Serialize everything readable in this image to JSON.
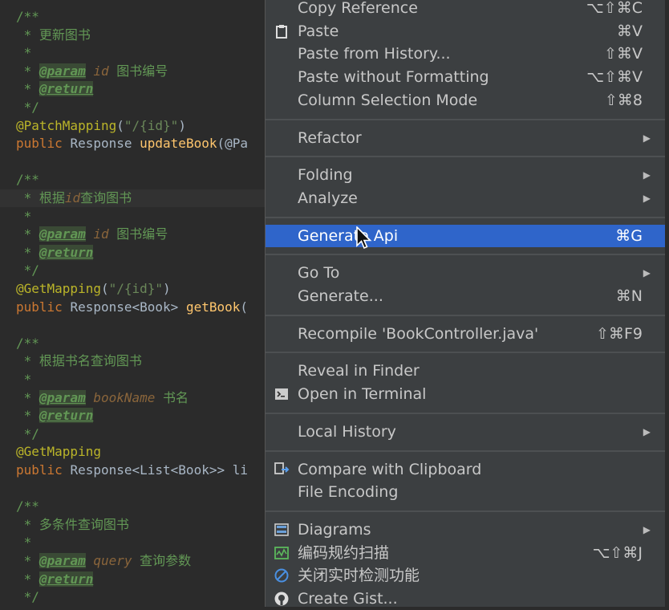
{
  "editor": {
    "lines": [
      [
        [
          "tok-comment",
          "/**"
        ]
      ],
      [
        [
          "tok-comment",
          " * 更新图书"
        ]
      ],
      [
        [
          "tok-comment",
          " *"
        ]
      ],
      [
        [
          "tok-comment",
          " * "
        ],
        [
          "tok-tag",
          "@param"
        ],
        [
          "tok-comment",
          " "
        ],
        [
          "tok-param",
          "id"
        ],
        [
          "tok-comment",
          " 图书编号"
        ]
      ],
      [
        [
          "tok-comment",
          " * "
        ],
        [
          "tok-tag",
          "@return"
        ]
      ],
      [
        [
          "tok-comment",
          " */"
        ]
      ],
      [
        [
          "tok-anno",
          "@PatchMapping"
        ],
        [
          "tok-plain",
          "("
        ],
        [
          "tok-str",
          "\"/{id}\""
        ],
        [
          "tok-plain",
          ")"
        ]
      ],
      [
        [
          "tok-kw",
          "public "
        ],
        [
          "tok-plain",
          "Response "
        ],
        [
          "tok-method",
          "updateBook"
        ],
        [
          "tok-plain",
          "(@Pa"
        ]
      ],
      [],
      [
        [
          "tok-comment",
          "/**"
        ]
      ],
      [
        [
          "tok-comment",
          " * 根据"
        ],
        [
          "tok-param",
          "id"
        ],
        [
          "tok-comment",
          "查询图书"
        ]
      ],
      [
        [
          "tok-comment",
          " *"
        ]
      ],
      [
        [
          "tok-comment",
          " * "
        ],
        [
          "tok-tag",
          "@param"
        ],
        [
          "tok-comment",
          " "
        ],
        [
          "tok-param",
          "id"
        ],
        [
          "tok-comment",
          " 图书编号"
        ]
      ],
      [
        [
          "tok-comment",
          " * "
        ],
        [
          "tok-tag",
          "@return"
        ]
      ],
      [
        [
          "tok-comment",
          " */"
        ]
      ],
      [
        [
          "tok-anno",
          "@GetMapping"
        ],
        [
          "tok-plain",
          "("
        ],
        [
          "tok-str",
          "\"/{id}\""
        ],
        [
          "tok-plain",
          ")"
        ]
      ],
      [
        [
          "tok-kw",
          "public "
        ],
        [
          "tok-plain",
          "Response<Book> "
        ],
        [
          "tok-method",
          "getBook"
        ],
        [
          "tok-plain",
          "("
        ]
      ],
      [],
      [
        [
          "tok-comment",
          "/**"
        ]
      ],
      [
        [
          "tok-comment",
          " * 根据书名查询图书"
        ]
      ],
      [
        [
          "tok-comment",
          " *"
        ]
      ],
      [
        [
          "tok-comment",
          " * "
        ],
        [
          "tok-tag",
          "@param"
        ],
        [
          "tok-comment",
          " "
        ],
        [
          "tok-param",
          "bookName"
        ],
        [
          "tok-comment",
          " 书名"
        ]
      ],
      [
        [
          "tok-comment",
          " * "
        ],
        [
          "tok-tag",
          "@return"
        ]
      ],
      [
        [
          "tok-comment",
          " */"
        ]
      ],
      [
        [
          "tok-anno",
          "@GetMapping"
        ]
      ],
      [
        [
          "tok-kw",
          "public "
        ],
        [
          "tok-plain",
          "Response<List<Book>> li"
        ]
      ],
      [],
      [
        [
          "tok-comment",
          "/**"
        ]
      ],
      [
        [
          "tok-comment",
          " * 多条件查询图书"
        ]
      ],
      [
        [
          "tok-comment",
          " *"
        ]
      ],
      [
        [
          "tok-comment",
          " * "
        ],
        [
          "tok-tag",
          "@param"
        ],
        [
          "tok-comment",
          " "
        ],
        [
          "tok-param",
          "query"
        ],
        [
          "tok-comment",
          " 查询参数"
        ]
      ],
      [
        [
          "tok-comment",
          " * "
        ],
        [
          "tok-tag",
          "@return"
        ]
      ],
      [
        [
          "tok-comment",
          " */"
        ]
      ]
    ],
    "current_line_index": 10
  },
  "menu": {
    "items": [
      {
        "label": "Copy Reference",
        "shortcut": "⌥⇧⌘C"
      },
      {
        "label": "Paste",
        "shortcut": "⌘V",
        "icon": "clipboard-icon"
      },
      {
        "label": "Paste from History...",
        "shortcut": "⇧⌘V"
      },
      {
        "label": "Paste without Formatting",
        "shortcut": "⌥⇧⌘V"
      },
      {
        "label": "Column Selection Mode",
        "shortcut": "⇧⌘8"
      },
      {
        "separator": true
      },
      {
        "label": "Refactor",
        "submenu": true
      },
      {
        "separator": true
      },
      {
        "label": "Folding",
        "submenu": true
      },
      {
        "label": "Analyze",
        "submenu": true
      },
      {
        "separator": true
      },
      {
        "label": "Generate Api",
        "shortcut": "⌘G",
        "selected": true
      },
      {
        "separator": true
      },
      {
        "label": "Go To",
        "submenu": true
      },
      {
        "label": "Generate...",
        "shortcut": "⌘N"
      },
      {
        "separator": true
      },
      {
        "label": "Recompile 'BookController.java'",
        "shortcut": "⇧⌘F9"
      },
      {
        "separator": true
      },
      {
        "label": "Reveal in Finder"
      },
      {
        "label": "Open in Terminal",
        "icon": "terminal-icon"
      },
      {
        "separator": true
      },
      {
        "label": "Local History",
        "submenu": true
      },
      {
        "separator": true
      },
      {
        "label": "Compare with Clipboard",
        "icon": "compare-icon"
      },
      {
        "label": "File Encoding"
      },
      {
        "separator": true
      },
      {
        "label": "Diagrams",
        "submenu": true,
        "icon": "diagram-icon"
      },
      {
        "label": "编码规约扫描",
        "shortcut": "⌥⇧⌘J",
        "icon": "scan-icon"
      },
      {
        "label": "关闭实时检测功能",
        "icon": "disable-icon"
      },
      {
        "label": "Create Gist...",
        "icon": "github-icon"
      }
    ]
  }
}
